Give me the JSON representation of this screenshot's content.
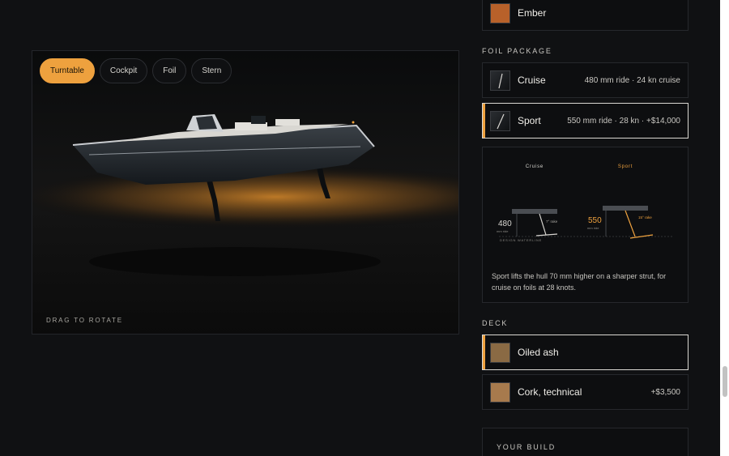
{
  "viewer": {
    "tabs": [
      {
        "label": "Turntable",
        "active": true
      },
      {
        "label": "Cockpit",
        "active": false
      },
      {
        "label": "Foil",
        "active": false
      },
      {
        "label": "Stern",
        "active": false
      }
    ],
    "drag_hint": "DRAG TO ROTATE"
  },
  "hull_colour": {
    "selected_partial": {
      "name": "Ember",
      "swatch_color": "#b8612a"
    }
  },
  "foil_package": {
    "title": "FOIL PACKAGE",
    "options": [
      {
        "name": "Cruise",
        "meta": "480 mm ride · 24 kn cruise",
        "selected": false
      },
      {
        "name": "Sport",
        "meta": "550 mm ride · 28 kn · +$14,000",
        "selected": true
      }
    ],
    "comparison": {
      "cruise_label": "Cruise",
      "sport_label": "Sport",
      "cruise_value": "480",
      "cruise_unit": "mm ride",
      "sport_value": "550",
      "sport_unit": "mm ride",
      "cruise_rake": "7° rake",
      "sport_rake": "15° rake",
      "waterline_label": "DESIGN WATERLINE",
      "caption": "Sport lifts the hull 70 mm higher on a sharper strut, for cruise on foils at 28 knots."
    }
  },
  "deck": {
    "title": "DECK",
    "options": [
      {
        "name": "Oiled ash",
        "meta": "",
        "selected": true,
        "swatch_color": "#8a6a44"
      },
      {
        "name": "Cork, technical",
        "meta": "+$3,500",
        "selected": false,
        "swatch_color": "#a77a4d"
      }
    ]
  },
  "build": {
    "title": "YOUR BUILD"
  },
  "colors": {
    "accent": "#eea13e",
    "background": "#101113"
  }
}
